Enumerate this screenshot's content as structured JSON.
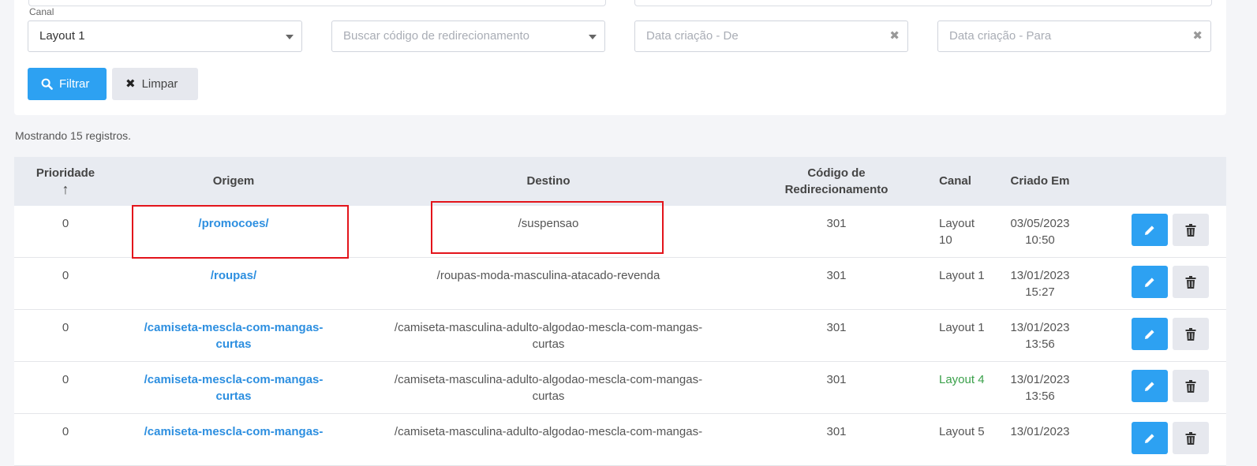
{
  "filters": {
    "canal_label": "Canal",
    "canal_value": "Layout 1",
    "redirect_placeholder": "Buscar código de redirecionamento",
    "date_from_placeholder": "Data criação - De",
    "date_to_placeholder": "Data criação - Para",
    "filter_button": "Filtrar",
    "clear_button": "Limpar"
  },
  "info": "Mostrando 15 registros.",
  "table": {
    "headers": {
      "priority": "Prioridade",
      "priority_sort": "↑",
      "origin": "Origem",
      "destination": "Destino",
      "code_line1": "Código de",
      "code_line2": "Redirecionamento",
      "canal": "Canal",
      "created": "Criado Em"
    },
    "rows": [
      {
        "priority": "0",
        "origin1": "/promocoes/",
        "origin2": "",
        "dest1": "/suspensao",
        "dest2": "",
        "code": "301",
        "canal1": "Layout",
        "canal2": "10",
        "date": "03/05/2023",
        "time": "10:50"
      },
      {
        "priority": "0",
        "origin1": "/roupas/",
        "origin2": "",
        "dest1": "/roupas-moda-masculina-atacado-revenda",
        "dest2": "",
        "code": "301",
        "canal1": "Layout 1",
        "canal2": "",
        "date": "13/01/2023",
        "time": "15:27"
      },
      {
        "priority": "0",
        "origin1": "/camiseta-mescla-com-mangas-",
        "origin2": "curtas",
        "dest1": "/camiseta-masculina-adulto-algodao-mescla-com-mangas-",
        "dest2": "curtas",
        "code": "301",
        "canal1": "Layout 1",
        "canal2": "",
        "date": "13/01/2023",
        "time": "13:56"
      },
      {
        "priority": "0",
        "origin1": "/camiseta-mescla-com-mangas-",
        "origin2": "curtas",
        "dest1": "/camiseta-masculina-adulto-algodao-mescla-com-mangas-",
        "dest2": "curtas",
        "code": "301",
        "canal1": "Layout 4",
        "canal2": "",
        "date": "13/01/2023",
        "time": "13:56"
      },
      {
        "priority": "0",
        "origin1": "/camiseta-mescla-com-mangas-",
        "origin2": "",
        "dest1": "/camiseta-masculina-adulto-algodao-mescla-com-mangas-",
        "dest2": "",
        "code": "301",
        "canal1": "Layout 5",
        "canal2": "",
        "date": "13/01/2023",
        "time": ""
      }
    ]
  },
  "colors": {
    "primary": "#2da1f2",
    "link": "#2d8fe0",
    "highlight": "#e3141b",
    "green": "#3aa04a"
  }
}
